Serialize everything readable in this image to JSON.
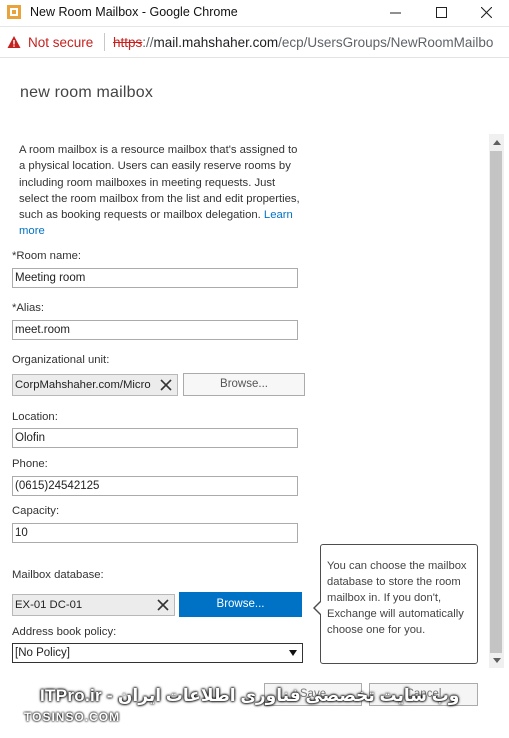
{
  "window": {
    "title": "New Room Mailbox - Google Chrome",
    "icon": "exchange-icon"
  },
  "address_bar": {
    "security_label": "Not secure",
    "url_scheme": "https",
    "url_sep": "://",
    "url_host": "mail.mahshaher.com",
    "url_path": "/ecp/UsersGroups/NewRoomMailbo"
  },
  "page": {
    "title": "new room mailbox",
    "description": "A room mailbox is a resource mailbox that's assigned to a physical location. Users can easily reserve rooms by including room mailboxes in meeting requests. Just select the room mailbox from the list and edit properties, such as booking requests or mailbox delegation.",
    "learn_more": "Learn more"
  },
  "form": {
    "room_name_label": "*Room name:",
    "room_name_value": "Meeting room",
    "alias_label": "*Alias:",
    "alias_value": "meet.room",
    "ou_label": "Organizational unit:",
    "ou_value": "CorpMahshaher.com/Micro",
    "browse_label": "Browse...",
    "location_label": "Location:",
    "location_value": "Olofin",
    "phone_label": "Phone:",
    "phone_value": "(0615)24542125",
    "capacity_label": "Capacity:",
    "capacity_value": "10",
    "mailbox_db_label": "Mailbox database:",
    "mailbox_db_value": "EX-01 DC-01",
    "db_browse_label": "Browse...",
    "address_book_label": "Address book policy:",
    "address_book_value": "[No Policy]"
  },
  "callout": {
    "text": "You can choose the mailbox database to store the room mailbox in. If you don't, Exchange will automatically choose one for you."
  },
  "footer": {
    "save_label": "Save",
    "cancel_label": "Cancel"
  },
  "watermark": {
    "text": "ITPro.ir - وب سایت تخصصی فناوری اطلاعات ایران",
    "sub": "TOSINSO.COM"
  },
  "colors": {
    "accent": "#0072c6",
    "warning": "#c5221f"
  }
}
